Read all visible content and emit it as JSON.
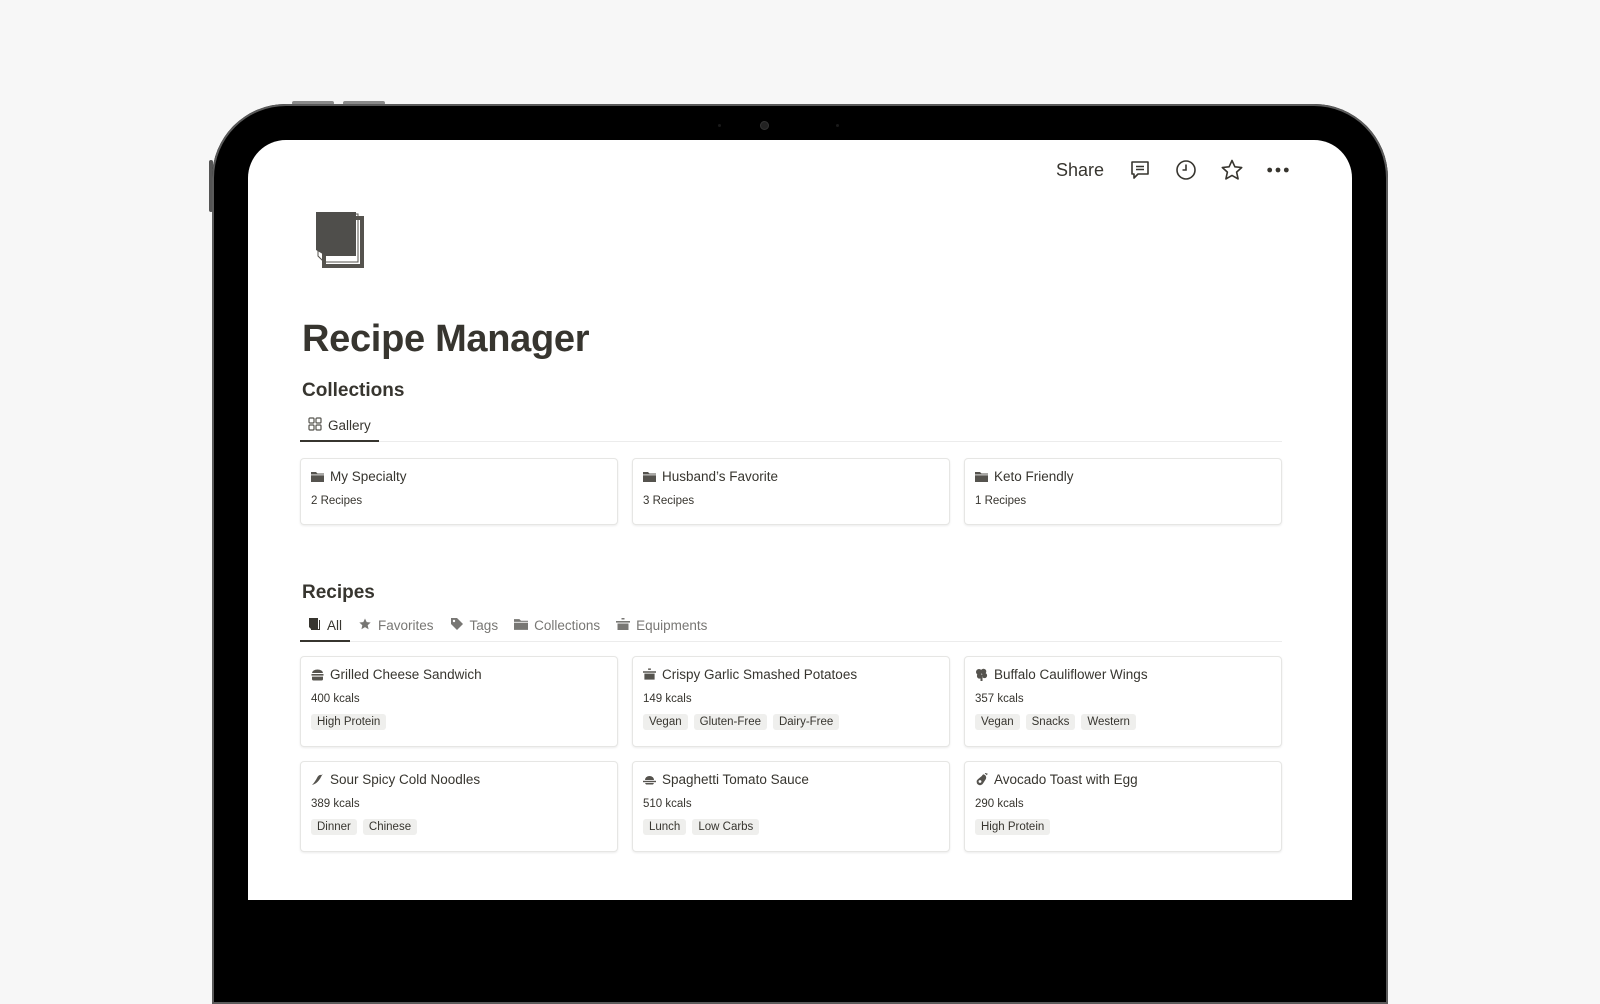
{
  "topbar": {
    "share_label": "Share",
    "icons": [
      "comment-icon",
      "history-clock-icon",
      "favorite-star-icon",
      "more-dots-icon"
    ]
  },
  "page": {
    "icon": "notebook-icon",
    "title": "Recipe Manager"
  },
  "collections": {
    "heading": "Collections",
    "view": {
      "icon": "gallery-grid-icon",
      "label": "Gallery"
    },
    "items": [
      {
        "icon": "folder-icon",
        "name": "My Specialty",
        "count": "2 Recipes"
      },
      {
        "icon": "folder-icon",
        "name": "Husband’s Favorite",
        "count": "3 Recipes"
      },
      {
        "icon": "folder-icon",
        "name": "Keto Friendly",
        "count": "1 Recipes"
      }
    ]
  },
  "recipes": {
    "heading": "Recipes",
    "tabs": [
      {
        "icon": "book-icon",
        "label": "All",
        "active": true
      },
      {
        "icon": "star-icon",
        "label": "Favorites",
        "active": false
      },
      {
        "icon": "tag-icon",
        "label": "Tags",
        "active": false
      },
      {
        "icon": "folder-icon",
        "label": "Collections",
        "active": false
      },
      {
        "icon": "pot-icon",
        "label": "Equipments",
        "active": false
      }
    ],
    "items": [
      {
        "icon": "burger-icon",
        "name": "Grilled Cheese Sandwich",
        "kcals": "400 kcals",
        "tags": [
          "High Protein"
        ]
      },
      {
        "icon": "pot-icon",
        "name": "Crispy Garlic Smashed Potatoes",
        "kcals": "149 kcals",
        "tags": [
          "Vegan",
          "Gluten-Free",
          "Dairy-Free"
        ]
      },
      {
        "icon": "cauliflower-icon",
        "name": "Buffalo Cauliflower Wings",
        "kcals": "357 kcals",
        "tags": [
          "Vegan",
          "Snacks",
          "Western"
        ]
      },
      {
        "icon": "chili-pepper-icon",
        "name": "Sour Spicy Cold Noodles",
        "kcals": "389 kcals",
        "tags": [
          "Dinner",
          "Chinese"
        ]
      },
      {
        "icon": "dish-icon",
        "name": "Spaghetti Tomato Sauce",
        "kcals": "510 kcals",
        "tags": [
          "Lunch",
          "Low Carbs"
        ]
      },
      {
        "icon": "avocado-icon",
        "name": "Avocado Toast with Egg",
        "kcals": "290 kcals",
        "tags": [
          "High Protein"
        ]
      }
    ]
  }
}
